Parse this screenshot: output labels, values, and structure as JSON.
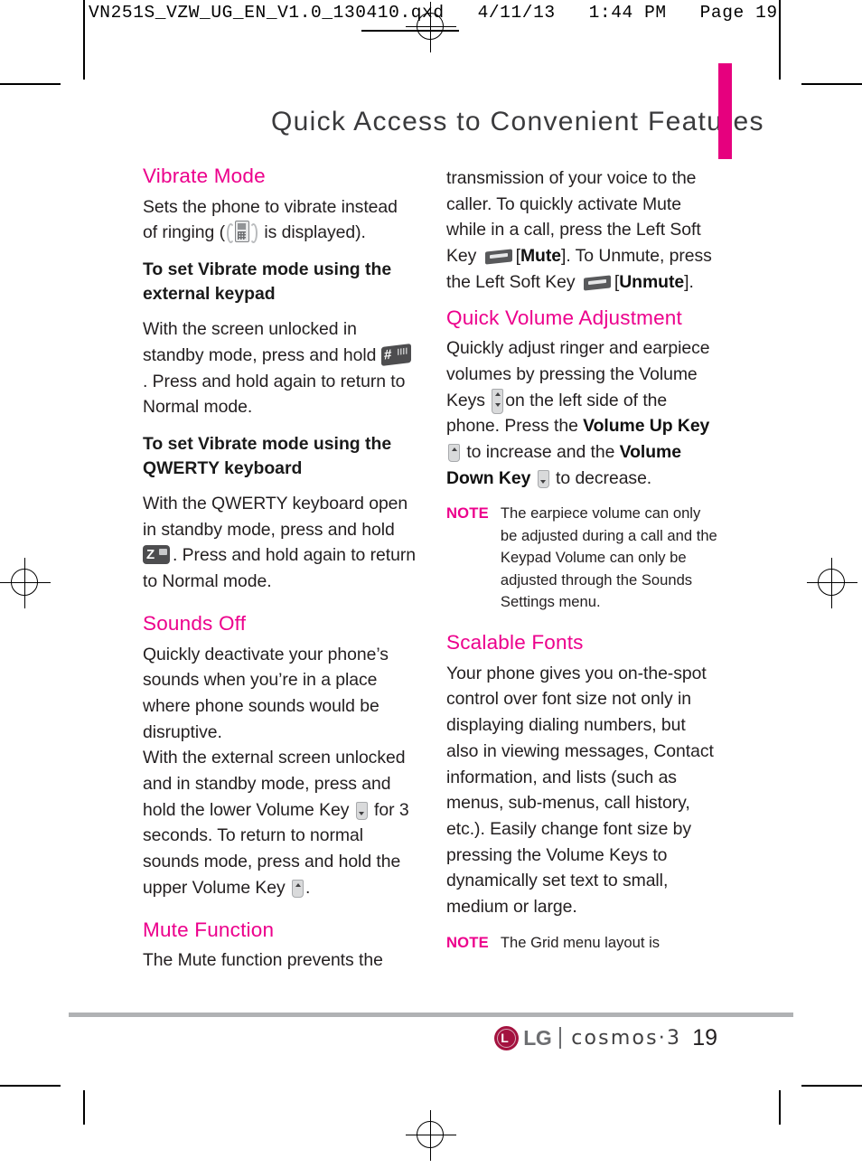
{
  "print_marks": {
    "file_stamp": "VN251S_VZW_UG_EN_V1.0_130410.qxd   4/11/13   1:44 PM   Page 19"
  },
  "header": {
    "title": "Quick Access to Convenient Features",
    "accent_color": "#e6007e"
  },
  "left_column": {
    "section1": {
      "heading": "Vibrate Mode",
      "intro_a": "Sets the phone to vibrate instead of ringing (",
      "intro_b": " is displayed).",
      "sub1": "To set Vibrate mode using the external keypad",
      "body1_a": "With the screen unlocked in standby mode, press and hold",
      "body1_b": ". Press and hold again to return to Normal mode.",
      "sub2": "To set Vibrate mode using the QWERTY keyboard",
      "body2_a": "With the QWERTY keyboard open in standby mode, press and hold",
      "body2_b": ". Press and hold again to return to Normal mode."
    },
    "section2": {
      "heading": "Sounds Off",
      "body_a": "Quickly deactivate your phone’s sounds when you’re in a place where phone sounds would be disruptive.",
      "body_b": "With the external screen unlocked and in standby mode, press and hold the lower Volume Key",
      "body_c": "for 3 seconds. To return to normal sounds mode, press and hold the upper Volume Key",
      "body_d": "."
    },
    "section3": {
      "heading": "Mute Function",
      "body": "The Mute function prevents the"
    }
  },
  "right_column": {
    "mute_continued": {
      "part_a": "transmission of your voice to the caller. To quickly activate Mute while in a call, press the Left Soft Key",
      "bracket1": "[",
      "bold1": "Mute",
      "part_b": "]. To Unmute, press the Left Soft Key",
      "bracket2": "[",
      "bold2": "Unmute",
      "part_c": "]."
    },
    "section_volume": {
      "heading": "Quick Volume Adjustment",
      "part_a": "Quickly adjust ringer and earpiece volumes by pressing the Volume Keys",
      "part_b": "on the left side of the phone. Press the",
      "bold_up": "Volume Up Key",
      "part_c": "to increase and the",
      "bold_down": "Volume Down Key",
      "part_d": "to decrease."
    },
    "note_volume": {
      "label": "NOTE",
      "text": "The earpiece volume can only be adjusted during a call and the Keypad Volume can only be adjusted through the Sounds Settings menu."
    },
    "section_fonts": {
      "heading": "Scalable Fonts",
      "body": "Your phone gives you on-the-spot control over font size not only in displaying dialing numbers, but also in viewing messages, Contact information, and lists (such as menus, sub-menus, call history, etc.). Easily change font size by pressing the Volume Keys to dynamically set text to small, medium or large."
    },
    "note_grid": {
      "label": "NOTE",
      "text": "The Grid menu layout is"
    }
  },
  "footer": {
    "brand": "LG",
    "model": "cosmos·3",
    "page_number": "19"
  },
  "icons": {
    "vibrate": "vibrate-phone-icon",
    "hash_key": "hash-key-icon",
    "z_key": "z-key-icon",
    "soft_key": "left-soft-key-icon",
    "volume_up": "volume-up-key-icon",
    "volume_down": "volume-down-key-icon",
    "volume_both": "volume-keys-icon"
  }
}
